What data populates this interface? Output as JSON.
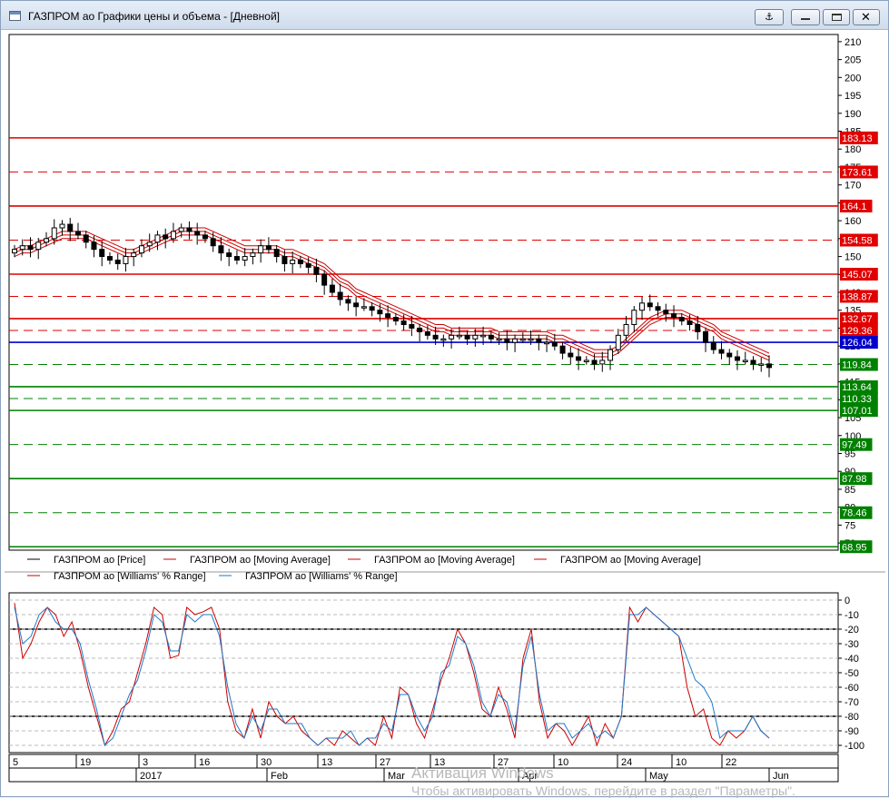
{
  "window": {
    "title": "ГАЗПРОМ ао Графики цены и объема - [Дневной]"
  },
  "price_axis": {
    "ticks": [
      "210",
      "205",
      "200",
      "195",
      "190",
      "185",
      "180",
      "175",
      "170",
      "165",
      "160",
      "155",
      "150",
      "145",
      "140",
      "135",
      "130",
      "125",
      "120",
      "115",
      "110",
      "105",
      "100",
      "95",
      "90",
      "85",
      "80",
      "75",
      "70"
    ]
  },
  "levels": [
    {
      "value": 183.13,
      "label": "183.13",
      "color": "#e00000",
      "style": "solid"
    },
    {
      "value": 173.61,
      "label": "173.61",
      "color": "#e00000",
      "style": "dashed"
    },
    {
      "value": 164.1,
      "label": "164.1",
      "color": "#e00000",
      "style": "solid"
    },
    {
      "value": 154.58,
      "label": "154.58",
      "color": "#e00000",
      "style": "dashed"
    },
    {
      "value": 145.07,
      "label": "145.07",
      "color": "#e00000",
      "style": "solid"
    },
    {
      "value": 138.87,
      "label": "138.87",
      "color": "#e00000",
      "style": "dashed"
    },
    {
      "value": 132.67,
      "label": "132.67",
      "color": "#e00000",
      "style": "solid"
    },
    {
      "value": 129.36,
      "label": "129.36",
      "color": "#e00000",
      "style": "dashed"
    },
    {
      "value": 126.04,
      "label": "126.04",
      "color": "#0000cc",
      "style": "solid"
    },
    {
      "value": 119.84,
      "label": "119.84",
      "color": "#008000",
      "style": "dashed"
    },
    {
      "value": 113.64,
      "label": "113.64",
      "color": "#008000",
      "style": "solid"
    },
    {
      "value": 110.33,
      "label": "110.33",
      "color": "#008000",
      "style": "dashed"
    },
    {
      "value": 107.01,
      "label": "107.01",
      "color": "#008000",
      "style": "solid"
    },
    {
      "value": 97.49,
      "label": "97.49",
      "color": "#008000",
      "style": "dashed"
    },
    {
      "value": 87.98,
      "label": "87.98",
      "color": "#008000",
      "style": "solid"
    },
    {
      "value": 78.46,
      "label": "78.46",
      "color": "#008000",
      "style": "dashed"
    },
    {
      "value": 68.95,
      "label": "68.95",
      "color": "#008000",
      "style": "solid"
    }
  ],
  "legend": [
    {
      "label": "ГАЗПРОМ ао [Price]",
      "color": "#000000"
    },
    {
      "label": "ГАЗПРОМ ао [Moving Average]",
      "color": "#cc0000"
    },
    {
      "label": "ГАЗПРОМ ао [Moving Average]",
      "color": "#cc0000"
    },
    {
      "label": "ГАЗПРОМ ао [Moving Average]",
      "color": "#cc0000"
    },
    {
      "label": "ГАЗПРОМ ао [Williams' % Range]",
      "color": "#cc0000"
    },
    {
      "label": "ГАЗПРОМ ао [Williams' % Range]",
      "color": "#1e78c8"
    }
  ],
  "wr_axis": {
    "ticks": [
      "0",
      "-10",
      "-20",
      "-30",
      "-40",
      "-50",
      "-60",
      "-70",
      "-80",
      "-90",
      "-100"
    ]
  },
  "date_axis": {
    "days": [
      "5",
      "19",
      "3",
      "16",
      "30",
      "13",
      "27",
      "13",
      "27",
      "10",
      "24",
      "10",
      "22"
    ],
    "months": [
      "2017",
      "Feb",
      "Mar",
      "Apr",
      "May",
      "Jun"
    ]
  },
  "watermark": {
    "line1": "Активация Windows",
    "line2": "Чтобы активировать Windows, перейдите в раздел \"Параметры\"."
  },
  "chart_data": [
    {
      "type": "candlestick",
      "name": "ГАЗПРОМ ао [Price]",
      "ylim": [
        68,
        212
      ],
      "close": [
        152,
        153,
        152,
        154,
        155,
        158,
        159,
        157,
        156,
        154,
        152,
        150,
        149,
        148,
        150,
        151,
        153,
        154,
        156,
        155,
        157,
        158,
        157,
        156,
        155,
        153,
        151,
        150,
        149,
        150,
        151,
        153,
        152,
        150,
        148,
        149,
        148,
        147,
        145,
        142,
        140,
        138,
        137,
        136,
        136,
        135,
        134,
        133,
        132,
        131,
        130,
        129,
        128,
        127,
        127,
        128,
        128,
        127,
        128,
        128,
        127,
        127,
        126,
        127,
        127,
        127,
        126,
        126,
        125,
        123,
        122,
        121,
        121,
        120,
        121,
        124,
        128,
        131,
        135,
        137,
        136,
        135,
        134,
        133,
        132,
        131,
        129,
        126,
        124,
        123,
        122,
        121,
        121,
        120,
        120,
        119
      ],
      "ma": [
        {
          "values": [
            150,
            151,
            151,
            152,
            153,
            154,
            155,
            155,
            155,
            155,
            154,
            153,
            152,
            151,
            150,
            150,
            151,
            152,
            153,
            154,
            155,
            156,
            156,
            156,
            156,
            155,
            154,
            153,
            152,
            151,
            151,
            151,
            151,
            151,
            150,
            150,
            149,
            148,
            147,
            146,
            144,
            142,
            141,
            139,
            138,
            137,
            136,
            135,
            134,
            133,
            132,
            131,
            130,
            129,
            129,
            128,
            128,
            128,
            128,
            128,
            128,
            127,
            127,
            127,
            127,
            127,
            127,
            127,
            126,
            126,
            125,
            124,
            123,
            122,
            122,
            122,
            123,
            125,
            127,
            129,
            131,
            132,
            133,
            133,
            133,
            132,
            131,
            130,
            129,
            127,
            126,
            125,
            124,
            123,
            122,
            121
          ]
        },
        {
          "values": [
            151,
            152,
            152,
            153,
            154,
            155,
            156,
            156,
            156,
            156,
            155,
            154,
            153,
            152,
            151,
            151,
            152,
            153,
            154,
            155,
            156,
            157,
            157,
            157,
            157,
            156,
            155,
            154,
            153,
            152,
            152,
            152,
            152,
            152,
            151,
            151,
            150,
            149,
            148,
            147,
            145,
            143,
            142,
            140,
            139,
            138,
            137,
            136,
            135,
            134,
            133,
            132,
            131,
            130,
            130,
            129,
            129,
            129,
            129,
            129,
            129,
            128,
            128,
            128,
            128,
            128,
            128,
            128,
            127,
            127,
            126,
            125,
            124,
            123,
            123,
            123,
            124,
            126,
            128,
            130,
            132,
            133,
            134,
            134,
            134,
            133,
            132,
            131,
            130,
            128,
            127,
            126,
            125,
            124,
            123,
            122
          ]
        },
        {
          "values": [
            152,
            153,
            153,
            154,
            155,
            156,
            157,
            157,
            157,
            157,
            156,
            155,
            154,
            153,
            152,
            152,
            153,
            154,
            155,
            156,
            157,
            158,
            158,
            158,
            158,
            157,
            156,
            155,
            154,
            153,
            153,
            153,
            153,
            153,
            152,
            152,
            151,
            150,
            149,
            148,
            146,
            144,
            143,
            141,
            140,
            139,
            138,
            137,
            136,
            135,
            134,
            133,
            132,
            131,
            131,
            130,
            130,
            130,
            130,
            130,
            130,
            129,
            129,
            129,
            129,
            129,
            129,
            129,
            128,
            128,
            127,
            126,
            125,
            124,
            124,
            124,
            125,
            127,
            129,
            131,
            133,
            134,
            135,
            135,
            135,
            134,
            133,
            132,
            131,
            129,
            128,
            127,
            126,
            125,
            124,
            123
          ]
        }
      ]
    },
    {
      "type": "line",
      "name": "Williams' % Range",
      "ylim": [
        -105,
        5
      ],
      "series": [
        {
          "name": "ГАЗПРОМ ао [Williams' % Range]",
          "values": [
            -2,
            -40,
            -30,
            -15,
            -5,
            -10,
            -25,
            -15,
            -35,
            -60,
            -80,
            -100,
            -90,
            -75,
            -70,
            -50,
            -30,
            -5,
            -10,
            -40,
            -38,
            -5,
            -10,
            -8,
            -5,
            -20,
            -70,
            -90,
            -95,
            -75,
            -95,
            -70,
            -80,
            -85,
            -80,
            -90,
            -95,
            -100,
            -95,
            -100,
            -90,
            -95,
            -100,
            -95,
            -100,
            -80,
            -95,
            -60,
            -65,
            -85,
            -95,
            -75,
            -55,
            -40,
            -20,
            -30,
            -50,
            -75,
            -80,
            -60,
            -75,
            -95,
            -40,
            -20,
            -70,
            -95,
            -85,
            -90,
            -100,
            -90,
            -80,
            -100,
            -85,
            -95,
            -80,
            -5,
            -15,
            -5,
            -10,
            -15,
            -20,
            -25,
            -60,
            -80,
            -75,
            -95,
            -100,
            -90,
            -95,
            -90,
            -80,
            -90,
            -95
          ]
        },
        {
          "name": "ГАЗПРОМ ао [Williams' % Range]",
          "values": [
            -5,
            -30,
            -25,
            -10,
            -5,
            -15,
            -20,
            -20,
            -30,
            -55,
            -75,
            -100,
            -95,
            -80,
            -65,
            -55,
            -35,
            -10,
            -15,
            -35,
            -35,
            -10,
            -15,
            -10,
            -10,
            -25,
            -60,
            -85,
            -95,
            -80,
            -90,
            -75,
            -75,
            -85,
            -85,
            -85,
            -95,
            -100,
            -95,
            -95,
            -95,
            -90,
            -100,
            -95,
            -95,
            -85,
            -90,
            -65,
            -65,
            -80,
            -90,
            -80,
            -50,
            -45,
            -25,
            -30,
            -45,
            -70,
            -80,
            -65,
            -70,
            -90,
            -45,
            -25,
            -65,
            -90,
            -85,
            -85,
            -95,
            -90,
            -85,
            -95,
            -90,
            -95,
            -80,
            -10,
            -10,
            -5,
            -10,
            -15,
            -20,
            -25,
            -40,
            -55,
            -60,
            -70,
            -95,
            -90,
            -90,
            -90,
            -80,
            -90,
            -95
          ]
        }
      ],
      "levels": [
        -20,
        -80
      ]
    }
  ]
}
